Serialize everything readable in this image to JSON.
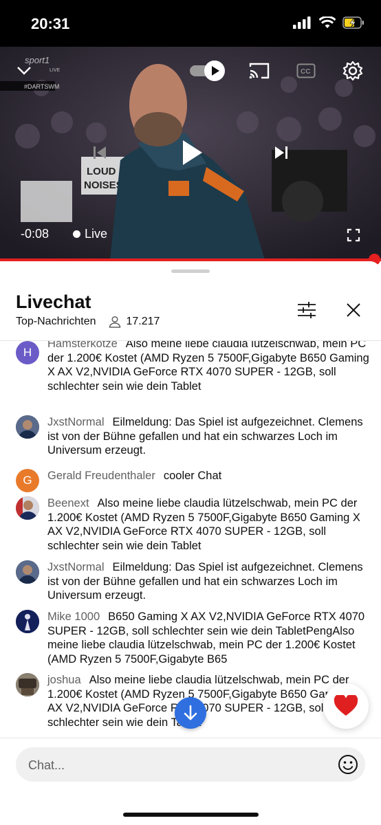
{
  "status_bar": {
    "time": "20:31"
  },
  "player": {
    "channel_logo": "sport1",
    "channel_logo_sub": "LIVE",
    "hashtag": "#DARTSWM",
    "sign_text_1": "LOUD",
    "sign_text_2": "NOISES",
    "timecode": "-0:08",
    "live_label": "Live",
    "progress_fraction": 0.97
  },
  "chat": {
    "title": "Livechat",
    "mode": "Top-Nachrichten",
    "viewer_count": "17.217",
    "messages": [
      {
        "author": "Hamsterkotze",
        "avatar_letter": "H",
        "avatar_color": "#6b5bc7",
        "text": "Also meine liebe claudia lützelschwab, mein PC der 1.200€ Kostet (AMD Ryzen 5 7500F,Gigabyte B650 Gaming X AX V2,NVIDIA GeForce RTX 4070 SUPER - 12GB, soll schlechter sein wie dein Tablet"
      },
      {
        "author": "JxstNormal",
        "avatar_letter": "",
        "avatar_color": "#3a4a6a",
        "text": "Eilmeldung: Das Spiel ist aufgezeichnet. Clemens ist von der Bühne gefallen und hat ein schwarzes Loch im Universum erzeugt."
      },
      {
        "author": "Gerald Freudenthaler",
        "avatar_letter": "G",
        "avatar_color": "#e87a2a",
        "text": "cooler Chat"
      },
      {
        "author": "Beenext",
        "avatar_letter": "",
        "avatar_color": "#b03030",
        "text": "Also meine liebe claudia lützelschwab, mein PC der 1.200€ Kostet (AMD Ryzen 5 7500F,Gigabyte B650 Gaming X AX V2,NVIDIA GeForce RTX 4070 SUPER - 12GB, soll schlechter sein wie dein Tablet"
      },
      {
        "author": "JxstNormal",
        "avatar_letter": "",
        "avatar_color": "#3a4a6a",
        "text": "Eilmeldung: Das Spiel ist aufgezeichnet. Clemens ist von der Bühne gefallen und hat ein schwarzes Loch im Universum erzeugt."
      },
      {
        "author": "Mike 1000",
        "avatar_letter": "",
        "avatar_color": "#1b2a6b",
        "text": "B650 Gaming X AX V2,NVIDIA GeForce RTX 4070 SUPER - 12GB, soll schlechter sein wie dein TabletPengAlso meine liebe claudia lützelschwab, mein PC der 1.200€ Kostet (AMD Ryzen 5 7500F,Gigabyte B65"
      },
      {
        "author": "joshua",
        "avatar_letter": "",
        "avatar_color": "#4a3a30",
        "text": "Also meine liebe claudia lützelschwab, mein PC der 1.200€ Kostet (AMD Ryzen 5 7500F,Gigabyte B650 Gaming X AX V2,NVIDIA GeForce RTX 4070 SUPER - 12GB, soll schlechter sein wie dein Tablet"
      }
    ],
    "input_placeholder": "Chat..."
  },
  "colors": {
    "accent": "#e52020",
    "scroll_button": "#2f6fe0",
    "heart": "#e02020"
  },
  "icons": [
    "chevron-down-icon",
    "autoplay-toggle-icon",
    "cast-icon",
    "captions-icon",
    "settings-icon",
    "previous-icon",
    "play-icon",
    "next-icon",
    "fullscreen-icon",
    "person-icon",
    "filter-icon",
    "close-icon",
    "arrow-down-icon",
    "heart-icon",
    "emoji-icon"
  ]
}
